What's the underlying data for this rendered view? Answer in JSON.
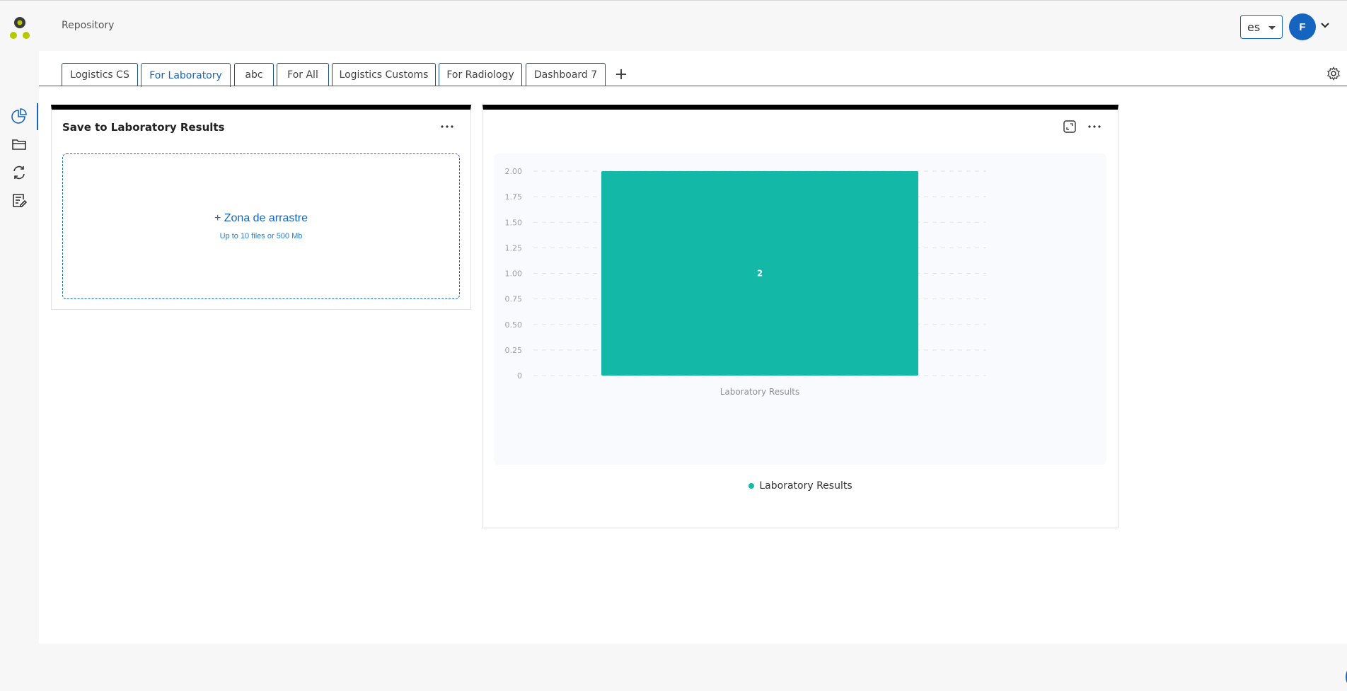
{
  "app": {
    "title": "Repository"
  },
  "header": {
    "language": "es",
    "avatar_initial": "F"
  },
  "sidebar": {
    "items": [
      {
        "name": "dashboards",
        "icon": "pie-chart-icon",
        "active": true
      },
      {
        "name": "folders",
        "icon": "folder-icon",
        "active": false
      },
      {
        "name": "sync",
        "icon": "sync-icon",
        "active": false
      },
      {
        "name": "reports",
        "icon": "edit-document-icon",
        "active": false
      }
    ]
  },
  "tabs": [
    {
      "label": "Logistics CS",
      "active": false
    },
    {
      "label": "For Laboratory",
      "active": true
    },
    {
      "label": "abc",
      "active": false
    },
    {
      "label": "For All",
      "active": false
    },
    {
      "label": "Logistics Customs",
      "active": false
    },
    {
      "label": "For Radiology",
      "active": false
    },
    {
      "label": "Dashboard 7",
      "active": false
    }
  ],
  "upload_widget": {
    "title": "Save to Laboratory Results",
    "dropzone_title": "+ Zona de arrastre",
    "dropzone_subtitle": "Up to 10 files or 500 Mb"
  },
  "chart_widget": {
    "legend_label": "Laboratory Results"
  },
  "colors": {
    "accent": "#1565c0",
    "bar": "#14b8a6",
    "logo_dark": "#3a3a3a",
    "logo_green": "#b5c800"
  },
  "chart_data": {
    "type": "bar",
    "categories": [
      "Laboratory Results"
    ],
    "series": [
      {
        "name": "Laboratory Results",
        "values": [
          2
        ]
      }
    ],
    "data_labels": [
      "2"
    ],
    "title": "",
    "xlabel": "",
    "ylabel": "",
    "ylim": [
      0,
      2
    ],
    "yticks": [
      "0",
      "0.25",
      "0.50",
      "0.75",
      "1.00",
      "1.25",
      "1.50",
      "1.75",
      "2.00"
    ],
    "grid": true,
    "legend": "bottom-center"
  }
}
